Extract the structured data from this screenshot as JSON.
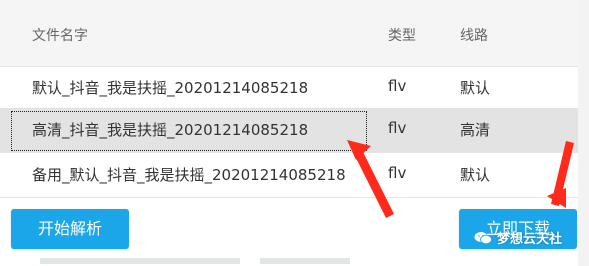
{
  "table": {
    "headers": {
      "filename": "文件名字",
      "type": "类型",
      "route": "线路"
    },
    "rows": [
      {
        "filename": "默认_抖音_我是扶摇_20201214085218",
        "type": "flv",
        "route": "默认",
        "selected": false
      },
      {
        "filename": "高清_抖音_我是扶摇_20201214085218",
        "type": "flv",
        "route": "高清",
        "selected": true
      },
      {
        "filename": "备用_默认_抖音_我是扶摇_20201214085218",
        "type": "flv",
        "route": "默认",
        "selected": false
      }
    ]
  },
  "buttons": {
    "parse": "开始解析",
    "download": "立即下载"
  },
  "watermark": {
    "text": "梦想云天社",
    "icon": "wechat-icon"
  },
  "annotations": {
    "arrow_color": "#ff2a1a"
  },
  "colors": {
    "accent": "#1aa6e8",
    "header_bg": "#f5f5f5",
    "selected_bg": "#e3e3e3"
  }
}
